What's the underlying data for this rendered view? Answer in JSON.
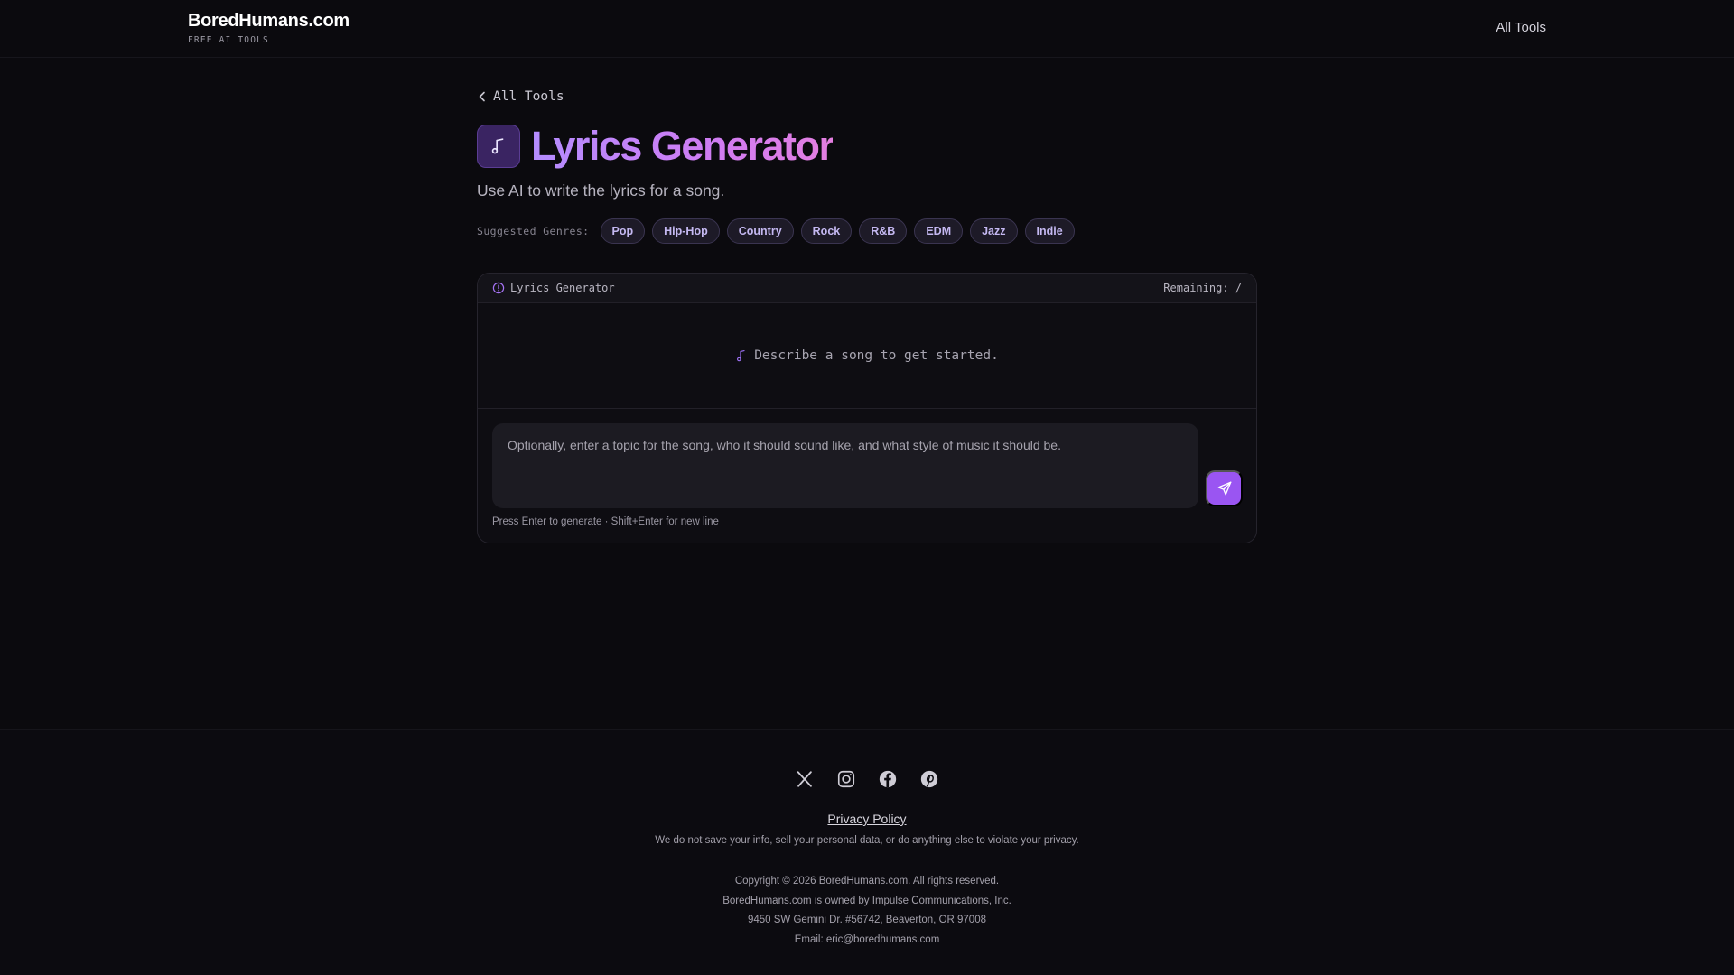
{
  "header": {
    "brand_title": "BoredHumans.com",
    "brand_subtitle": "FREE AI TOOLS",
    "nav_link": "All Tools"
  },
  "main": {
    "back_link": "All Tools",
    "title": "Lyrics Generator",
    "subtitle": "Use AI to write the lyrics for a song.",
    "genres_label": "Suggested Genres:",
    "genres": [
      "Pop",
      "Hip-Hop",
      "Country",
      "Rock",
      "R&B",
      "EDM",
      "Jazz",
      "Indie"
    ]
  },
  "panel": {
    "header_title": "Lyrics Generator",
    "remaining": "Remaining: /",
    "empty_message": "Describe a song to get started.",
    "input_placeholder": "Optionally, enter a topic for the song, who it should sound like, and what style of music it should be.",
    "hint": "Press Enter to generate · Shift+Enter for new line"
  },
  "footer": {
    "socials": [
      "x-icon",
      "instagram-icon",
      "facebook-icon",
      "pinterest-icon"
    ],
    "privacy_link": "Privacy Policy",
    "privacy_note": "We do not save your info, sell your personal data, or do anything else to violate your privacy.",
    "copyright": "Copyright © 2026 BoredHumans.com. All rights reserved.",
    "owner": "BoredHumans.com is owned by Impulse Communications, Inc.",
    "address": "9450 SW Gemini Dr. #56742, Beaverton, OR 97008",
    "email": "Email: eric@boredhumans.com"
  },
  "colors": {
    "background": "#0b0a0e",
    "accent": "#9a55f2",
    "title_gradient_start": "#b48cff",
    "title_gradient_end": "#e47ee0"
  }
}
